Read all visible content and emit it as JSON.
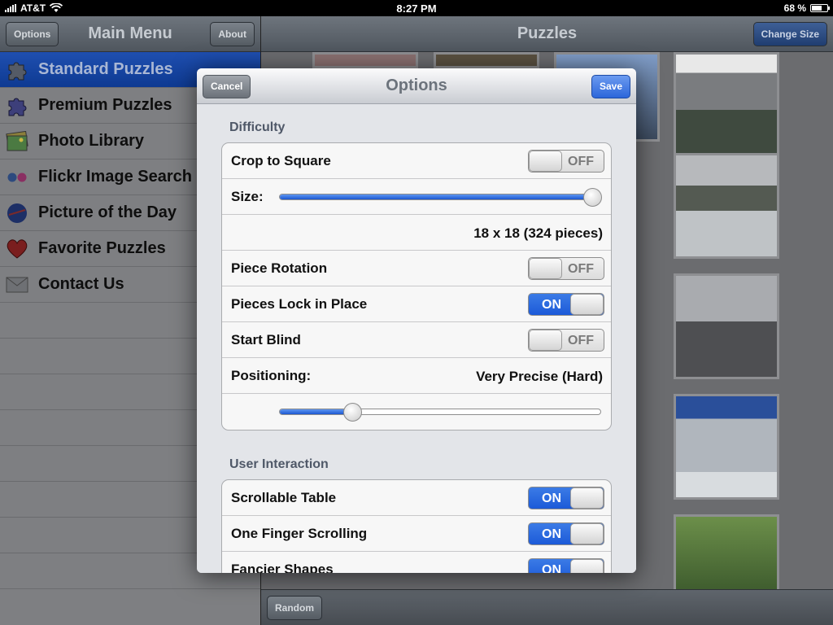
{
  "status": {
    "carrier": "AT&T",
    "time": "8:27 PM",
    "battery": "68 %",
    "battery_level": 0.68
  },
  "left_nav": {
    "options_label": "Options",
    "title": "Main Menu",
    "about_label": "About"
  },
  "menu": {
    "items": [
      {
        "label": "Standard Puzzles",
        "icon": "puzzle-icon"
      },
      {
        "label": "Premium Puzzles",
        "icon": "premium-puzzle-icon"
      },
      {
        "label": "Photo Library",
        "icon": "photo-library-icon"
      },
      {
        "label": "Flickr Image Search",
        "icon": "flickr-icon"
      },
      {
        "label": "Picture of the Day",
        "icon": "nasa-icon"
      },
      {
        "label": "Favorite Puzzles",
        "icon": "heart-icon"
      },
      {
        "label": "Contact Us",
        "icon": "envelope-icon"
      }
    ]
  },
  "right_nav": {
    "title": "Puzzles",
    "change_size_label": "Change Size"
  },
  "bottom": {
    "random_label": "Random"
  },
  "modal": {
    "title": "Options",
    "cancel_label": "Cancel",
    "save_label": "Save",
    "difficulty": {
      "header": "Difficulty",
      "crop_label": "Crop to Square",
      "crop_state": "OFF",
      "size_label": "Size:",
      "size_value": 1.0,
      "pieces_text": "18 x 18 (324 pieces)",
      "rotation_label": "Piece Rotation",
      "rotation_state": "OFF",
      "lock_label": "Pieces Lock in Place",
      "lock_state": "ON",
      "blind_label": "Start Blind",
      "blind_state": "OFF",
      "positioning_label": "Positioning:",
      "positioning_value": "Very Precise (Hard)",
      "positioning_slider": 0.21
    },
    "interaction": {
      "header": "User Interaction",
      "scroll_label": "Scrollable Table",
      "scroll_state": "ON",
      "finger_label": "One Finger Scrolling",
      "finger_state": "ON",
      "fancy_label": "Fancier Shapes",
      "fancy_state": "ON"
    }
  },
  "colors": {
    "accent_blue": "#2c66da",
    "selected_row": "#1f4fb0"
  }
}
